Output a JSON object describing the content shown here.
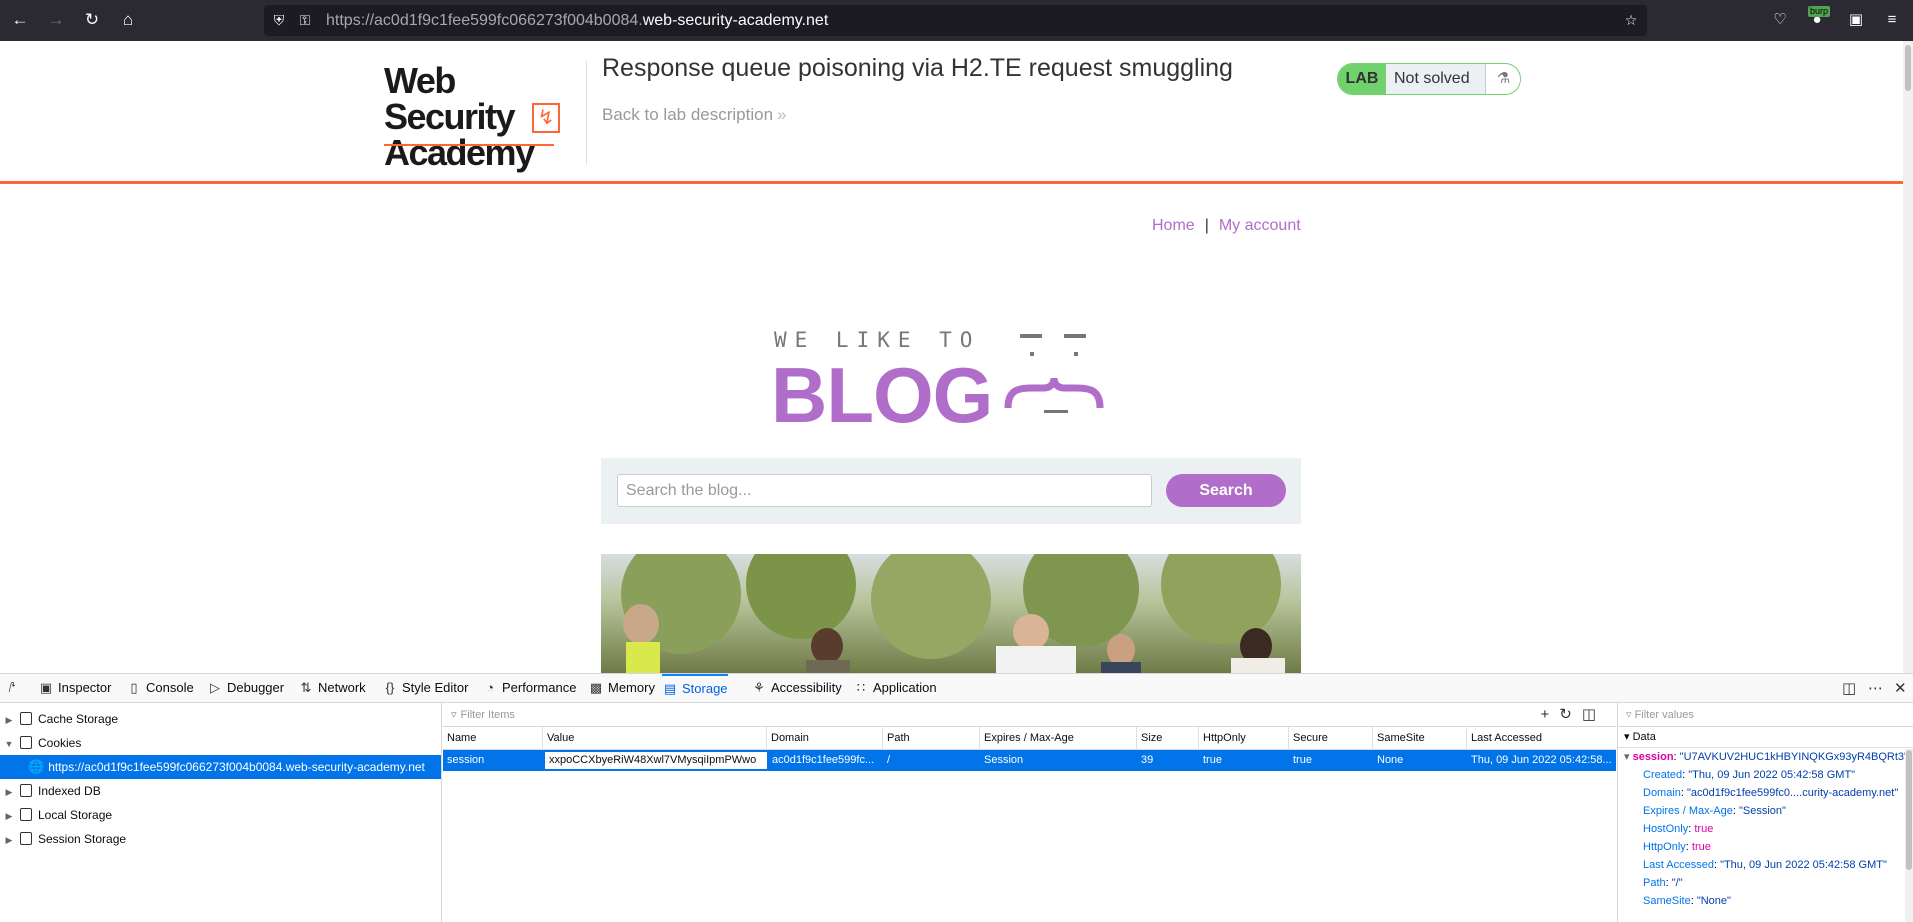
{
  "browser": {
    "url_prefix": "https://ac0d1f9c1fee599fc066273f004b0084.",
    "url_host": "web-security-academy.net",
    "burp_badge": "burp"
  },
  "lab": {
    "title": "Response queue poisoning via H2.TE request smuggling",
    "back_link": "Back to lab description",
    "status_label": "LAB",
    "status": "Not solved",
    "logo_line1": "Web Security",
    "logo_line2": "Academy"
  },
  "site": {
    "nav": {
      "home": "Home",
      "separator": "|",
      "account": "My account"
    },
    "blog_tagline": "WE LIKE TO",
    "blog_word": "BLOG",
    "search_placeholder": "Search the blog...",
    "search_button": "Search"
  },
  "devtools": {
    "tabs": [
      "Inspector",
      "Console",
      "Debugger",
      "Network",
      "Style Editor",
      "Performance",
      "Memory",
      "Storage",
      "Accessibility",
      "Application"
    ],
    "active_tab": "Storage",
    "tree": {
      "cache": "Cache Storage",
      "cookies": "Cookies",
      "cookie_host": "https://ac0d1f9c1fee599fc066273f004b0084.web-security-academy.net",
      "indexed": "Indexed DB",
      "local": "Local Storage",
      "session": "Session Storage"
    },
    "filter_placeholder": "Filter Items",
    "columns": [
      "Name",
      "Value",
      "Domain",
      "Path",
      "Expires / Max-Age",
      "Size",
      "HttpOnly",
      "Secure",
      "SameSite",
      "Last Accessed"
    ],
    "row": {
      "name": "session",
      "value": "xxpoCCXbyeRiW48Xwl7VMysqiIpmPWwo",
      "domain": "ac0d1f9c1fee599fc...",
      "path": "/",
      "expires": "Session",
      "size": "39",
      "httponly": "true",
      "secure": "true",
      "samesite": "None",
      "last_accessed": "Thu, 09 Jun 2022 05:42:58..."
    },
    "data_panel": {
      "filter_placeholder": "Filter values",
      "header": "Data",
      "root_key": "session",
      "root_value": "\"U7AVKUV2HUC1kHBYINQKGx93yR4BQRt3\"",
      "entries": [
        {
          "k": "Created",
          "v": "\"Thu, 09 Jun 2022 05:42:58 GMT\"",
          "pink": false
        },
        {
          "k": "Domain",
          "v": "\"ac0d1f9c1fee599fc0....curity-academy.net\"",
          "pink": false
        },
        {
          "k": "Expires / Max-Age",
          "v": "\"Session\"",
          "pink": false
        },
        {
          "k": "HostOnly",
          "v": "true",
          "pink": true
        },
        {
          "k": "HttpOnly",
          "v": "true",
          "pink": true
        },
        {
          "k": "Last Accessed",
          "v": "\"Thu, 09 Jun 2022 05:42:58 GMT\"",
          "pink": false
        },
        {
          "k": "Path",
          "v": "\"/\"",
          "pink": false
        },
        {
          "k": "SameSite",
          "v": "\"None\"",
          "pink": false
        }
      ]
    }
  }
}
